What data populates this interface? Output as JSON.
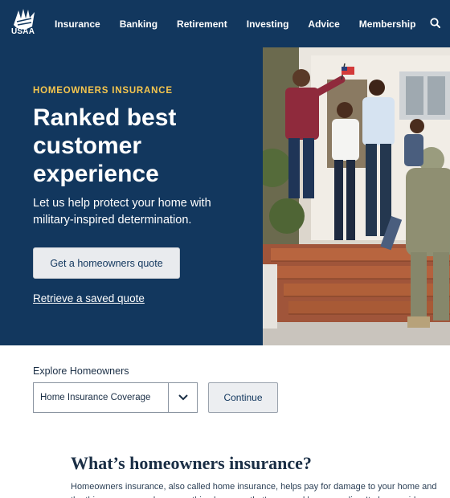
{
  "nav": {
    "logo_text": "USAA",
    "items": [
      "Insurance",
      "Banking",
      "Retirement",
      "Investing",
      "Advice",
      "Membership"
    ],
    "search_icon": "search-icon"
  },
  "hero": {
    "eyebrow": "HOMEOWNERS INSURANCE",
    "title": "Ranked best customer experience",
    "subtitle": "Let us help protect your home with military-inspired determination.",
    "primary_button": "Get a homeowners quote",
    "secondary_link": "Retrieve a saved quote",
    "photo": "family-welcoming-soldier-photo"
  },
  "explore": {
    "label": "Explore Homeowners",
    "select_value": "Home Insurance Coverage",
    "continue_label": "Continue"
  },
  "article": {
    "heading": "What’s homeowners insurance?",
    "paragraph": "Homeowners insurance, also called home insurance, helps pay for damage to your home and the things you own when something happens that's covered by your policy. It also provides"
  },
  "colors": {
    "navy": "#12375e",
    "gold": "#f6c64e"
  }
}
